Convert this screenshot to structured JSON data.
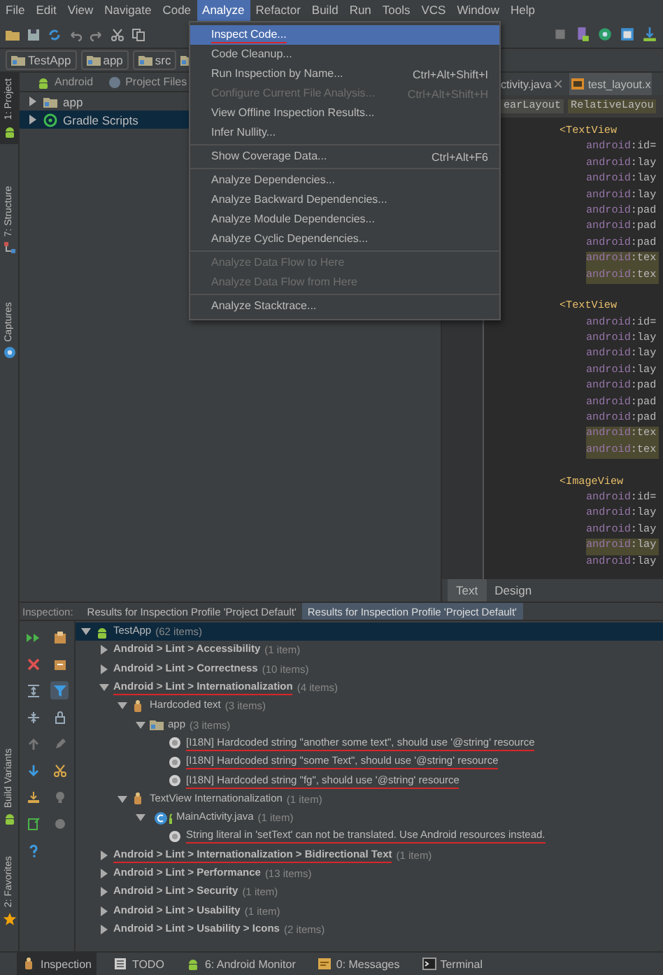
{
  "menu_bar": [
    {
      "label": "File",
      "selected": false
    },
    {
      "label": "Edit",
      "selected": false
    },
    {
      "label": "View",
      "selected": false
    },
    {
      "label": "Navigate",
      "selected": false
    },
    {
      "label": "Code",
      "selected": false
    },
    {
      "label": "Analyze",
      "selected": true
    },
    {
      "label": "Refactor",
      "selected": false
    },
    {
      "label": "Build",
      "selected": false
    },
    {
      "label": "Run",
      "selected": false
    },
    {
      "label": "Tools",
      "selected": false
    },
    {
      "label": "VCS",
      "selected": false
    },
    {
      "label": "Window",
      "selected": false
    },
    {
      "label": "Help",
      "selected": false
    }
  ],
  "breadcrumbs": [
    "TestApp",
    "app",
    "src"
  ],
  "left_stripe": {
    "top": [
      {
        "label": "1: Project",
        "kind": "android",
        "selected": true
      },
      {
        "label": "7: Structure",
        "kind": "structure",
        "selected": false
      },
      {
        "label": "Captures",
        "kind": "captures",
        "selected": false
      }
    ],
    "bottom": [
      {
        "label": "Build Variants",
        "kind": "android",
        "selected": false
      },
      {
        "label": "2: Favorites",
        "kind": "star",
        "selected": false
      }
    ]
  },
  "project_panel": {
    "views": [
      {
        "label": "Android",
        "kind": "android"
      },
      {
        "label": "Project Files",
        "kind": "files"
      }
    ],
    "items": [
      {
        "label": "app",
        "kind": "module",
        "selected": false
      },
      {
        "label": "Gradle Scripts",
        "kind": "gradle",
        "selected": true
      }
    ]
  },
  "editor": {
    "tabs": [
      {
        "label": "ctivity.java",
        "selected": false
      },
      {
        "label": "test_layout.x",
        "kind": "xml",
        "selected": true
      }
    ],
    "breadcrumbs": [
      "earLayout",
      "RelativeLayou"
    ],
    "blocks": [
      {
        "tag": "<TextView",
        "attributes": [
          {
            "text": "android:id=",
            "highlighted": false
          },
          {
            "text": "android:lay",
            "highlighted": false
          },
          {
            "text": "android:lay",
            "highlighted": false
          },
          {
            "text": "android:lay",
            "highlighted": false
          },
          {
            "text": "android:pad",
            "highlighted": false
          },
          {
            "text": "android:pad",
            "highlighted": false
          },
          {
            "text": "android:pad",
            "highlighted": false
          },
          {
            "text": "android:tex",
            "highlighted": true
          },
          {
            "text": "android:tex",
            "highlighted": true
          }
        ]
      },
      {
        "tag": "<TextView",
        "attributes": [
          {
            "text": "android:id=",
            "highlighted": false
          },
          {
            "text": "android:lay",
            "highlighted": false
          },
          {
            "text": "android:lay",
            "highlighted": false
          },
          {
            "text": "android:lay",
            "highlighted": false
          },
          {
            "text": "android:pad",
            "highlighted": false
          },
          {
            "text": "android:pad",
            "highlighted": false
          },
          {
            "text": "android:pad",
            "highlighted": false
          },
          {
            "text": "android:tex",
            "highlighted": true
          },
          {
            "text": "android:tex",
            "highlighted": true
          }
        ]
      },
      {
        "tag": "<ImageView",
        "attributes": [
          {
            "text": "android:id=",
            "highlighted": false
          },
          {
            "text": "android:lay",
            "highlighted": false
          },
          {
            "text": "android:lay",
            "highlighted": false
          },
          {
            "text": "android:lay",
            "highlighted": true
          },
          {
            "text": "android:lay",
            "highlighted": false
          }
        ]
      }
    ],
    "bottom_tabs": [
      {
        "label": "Text",
        "selected": true
      },
      {
        "label": "Design",
        "selected": false
      }
    ]
  },
  "menu": {
    "items": [
      {
        "kind": "item",
        "label": "Inspect Code...",
        "selected": true,
        "disabled": false,
        "underlined": true
      },
      {
        "kind": "item",
        "label": "Code Cleanup...",
        "selected": false,
        "disabled": false,
        "underlined": false
      },
      {
        "kind": "item",
        "label": "Run Inspection by Name...",
        "shortcut": "Ctrl+Alt+Shift+I",
        "selected": false,
        "disabled": false,
        "underlined": false
      },
      {
        "kind": "item",
        "label": "Configure Current File Analysis...",
        "shortcut": "Ctrl+Alt+Shift+H",
        "selected": false,
        "disabled": true,
        "underlined": false
      },
      {
        "kind": "item",
        "label": "View Offline Inspection Results...",
        "selected": false,
        "disabled": false,
        "underlined": false
      },
      {
        "kind": "item",
        "label": "Infer Nullity...",
        "selected": false,
        "disabled": false,
        "underlined": false
      },
      {
        "kind": "separator"
      },
      {
        "kind": "item",
        "label": "Show Coverage Data...",
        "shortcut": "Ctrl+Alt+F6",
        "selected": false,
        "disabled": false,
        "underlined": false
      },
      {
        "kind": "separator"
      },
      {
        "kind": "item",
        "label": "Analyze Dependencies...",
        "selected": false,
        "disabled": false,
        "underlined": false
      },
      {
        "kind": "item",
        "label": "Analyze Backward Dependencies...",
        "selected": false,
        "disabled": false,
        "underlined": false
      },
      {
        "kind": "item",
        "label": "Analyze Module Dependencies...",
        "selected": false,
        "disabled": false,
        "underlined": false
      },
      {
        "kind": "item",
        "label": "Analyze Cyclic Dependencies...",
        "selected": false,
        "disabled": false,
        "underlined": false
      },
      {
        "kind": "separator"
      },
      {
        "kind": "item",
        "label": "Analyze Data Flow to Here",
        "selected": false,
        "disabled": true,
        "underlined": false
      },
      {
        "kind": "item",
        "label": "Analyze Data Flow from Here",
        "selected": false,
        "disabled": true,
        "underlined": false
      },
      {
        "kind": "separator"
      },
      {
        "kind": "item",
        "label": "Analyze Stacktrace...",
        "selected": false,
        "disabled": false,
        "underlined": false
      }
    ]
  },
  "inspection": {
    "label": "Inspection:",
    "tabs": [
      {
        "label": "Results for Inspection Profile 'Project Default'",
        "selected": false
      },
      {
        "label": "Results for Inspection Profile 'Project Default'",
        "selected": true
      }
    ],
    "filter_active": true,
    "tree": {
      "label": "TestApp",
      "count": "(62 items)",
      "kind": "project",
      "expanded": true,
      "selected": true,
      "underlined": false,
      "children": [
        {
          "label": "Android > Lint > Accessibility",
          "count": "(1 item)",
          "kind": "category",
          "expanded": false,
          "selected": false,
          "underlined": false
        },
        {
          "label": "Android > Lint > Correctness",
          "count": "(10 items)",
          "kind": "category",
          "expanded": false,
          "selected": false,
          "underlined": false
        },
        {
          "label": "Android > Lint > Internationalization",
          "count": "(4 items)",
          "kind": "category",
          "expanded": true,
          "selected": false,
          "underlined": true,
          "children": [
            {
              "label": "Hardcoded text",
              "count": "(3 items)",
              "kind": "inspection",
              "expanded": true,
              "selected": false,
              "underlined": false,
              "children": [
                {
                  "label": "app",
                  "count": "(3 items)",
                  "kind": "module",
                  "expanded": true,
                  "selected": false,
                  "underlined": false,
                  "children": [
                    {
                      "label": "[I18N] Hardcoded string \"another some text\", should use '@string' resource",
                      "kind": "problem",
                      "selected": false,
                      "underlined": true
                    },
                    {
                      "label": "[I18N] Hardcoded string \"some Text\", should use '@string' resource",
                      "kind": "problem",
                      "selected": false,
                      "underlined": true
                    },
                    {
                      "label": "[I18N] Hardcoded string \"fg\", should use '@string' resource",
                      "kind": "problem",
                      "selected": false,
                      "underlined": true
                    }
                  ]
                }
              ]
            },
            {
              "label": "TextView Internationalization",
              "count": "(1 item)",
              "kind": "inspection",
              "expanded": true,
              "selected": false,
              "underlined": false,
              "children": [
                {
                  "label": "MainActivity.java",
                  "count": "(1 item)",
                  "kind": "class",
                  "expanded": true,
                  "selected": false,
                  "underlined": false,
                  "children": [
                    {
                      "label": "String literal in 'setText' can not be translated. Use Android resources instead.",
                      "kind": "problem",
                      "selected": false,
                      "underlined": true
                    }
                  ]
                }
              ]
            }
          ]
        },
        {
          "label": "Android > Lint > Internationalization > Bidirectional Text",
          "count": "(1 item)",
          "kind": "category",
          "expanded": false,
          "selected": false,
          "underlined": true
        },
        {
          "label": "Android > Lint > Performance",
          "count": "(13 items)",
          "kind": "category",
          "expanded": false,
          "selected": false,
          "underlined": false
        },
        {
          "label": "Android > Lint > Security",
          "count": "(1 item)",
          "kind": "category",
          "expanded": false,
          "selected": false,
          "underlined": false
        },
        {
          "label": "Android > Lint > Usability",
          "count": "(1 item)",
          "kind": "category",
          "expanded": false,
          "selected": false,
          "underlined": false
        },
        {
          "label": "Android > Lint > Usability > Icons",
          "count": "(2 items)",
          "kind": "category",
          "expanded": false,
          "selected": false,
          "underlined": false
        }
      ]
    }
  },
  "tool_windows": [
    {
      "label": "Inspection",
      "kind": "inspection",
      "selected": true
    },
    {
      "label": "TODO",
      "kind": "todo",
      "selected": false
    },
    {
      "label": "6: Android Monitor",
      "kind": "android",
      "selected": false
    },
    {
      "label": "0: Messages",
      "kind": "messages",
      "selected": false
    },
    {
      "label": "Terminal",
      "kind": "terminal",
      "selected": false
    }
  ]
}
